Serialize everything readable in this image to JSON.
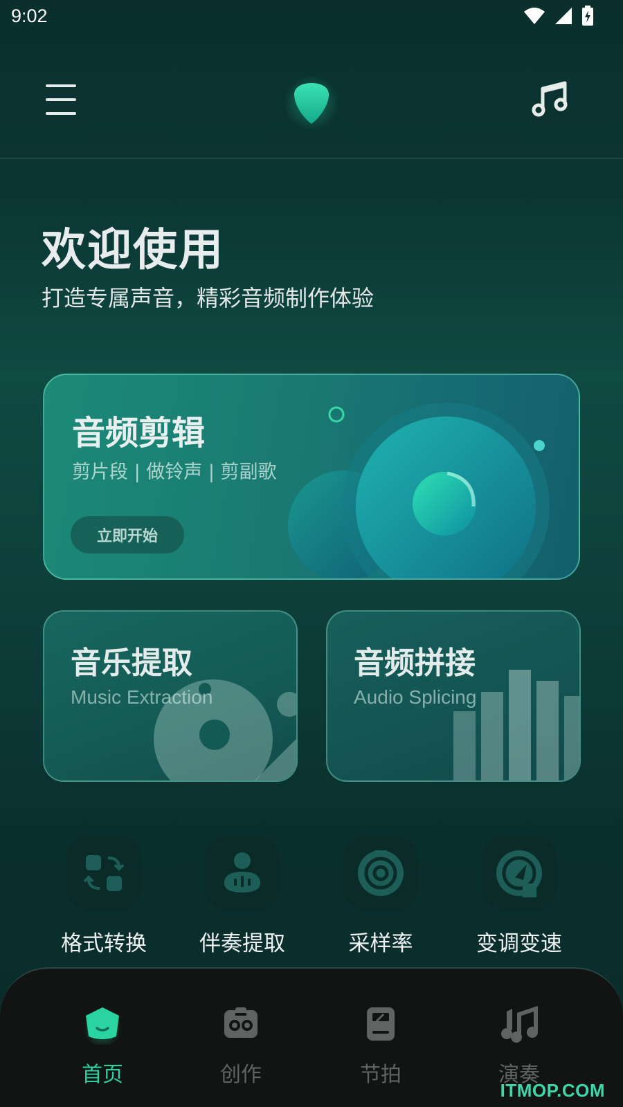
{
  "status_bar": {
    "time": "9:02"
  },
  "header": {
    "menu_icon": "hamburger-menu-icon",
    "logo_icon": "shield-pick-logo",
    "music_icon": "music-note-icon"
  },
  "welcome": {
    "title": "欢迎使用",
    "subtitle": "打造专属声音，精彩音频制作体验"
  },
  "main_card": {
    "title": "音频剪辑",
    "subtitle": "剪片段 | 做铃声 | 剪副歌",
    "button_label": "立即开始"
  },
  "feature_cards": [
    {
      "title": "音乐提取",
      "subtitle": "Music Extraction"
    },
    {
      "title": "音频拼接",
      "subtitle": "Audio Splicing"
    }
  ],
  "quick_tools": [
    {
      "label": "格式转换",
      "icon": "format-convert-icon"
    },
    {
      "label": "伴奏提取",
      "icon": "accompaniment-extract-icon"
    },
    {
      "label": "采样率",
      "icon": "sample-rate-icon"
    },
    {
      "label": "变调变速",
      "icon": "pitch-speed-icon"
    }
  ],
  "bottom_nav": [
    {
      "label": "首页",
      "icon": "home-icon",
      "active": true
    },
    {
      "label": "创作",
      "icon": "create-icon",
      "active": false
    },
    {
      "label": "节拍",
      "icon": "beat-icon",
      "active": false
    },
    {
      "label": "演奏",
      "icon": "perform-icon",
      "active": false
    }
  ],
  "watermark": "ITMOP.COM",
  "colors": {
    "accent": "#2ad4a0",
    "background": "#0b3633",
    "nav_background": "#121313"
  }
}
